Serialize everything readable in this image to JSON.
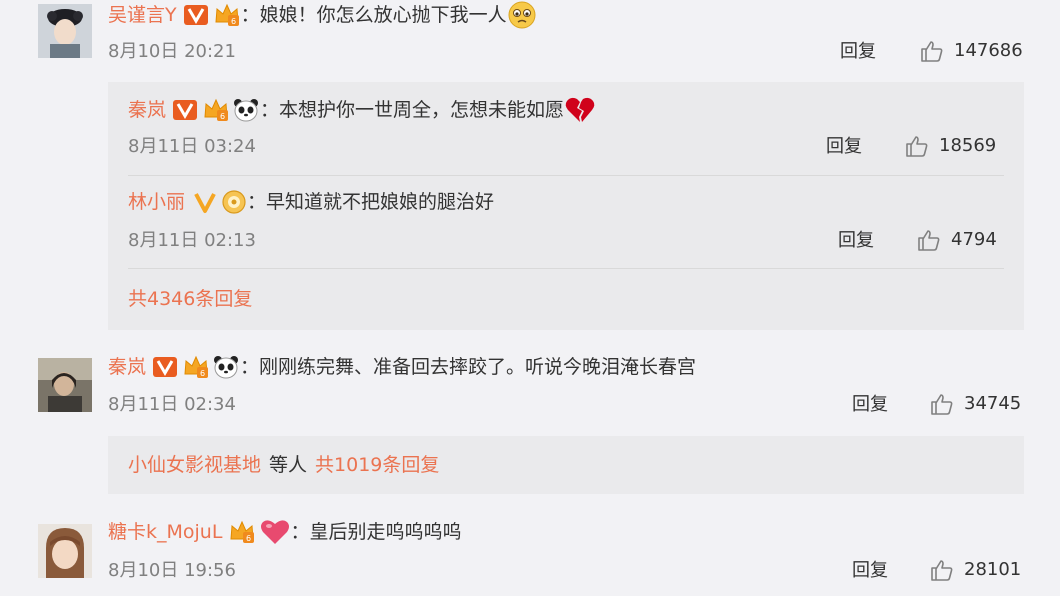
{
  "colors": {
    "page_bg": "#f2f2f5",
    "subbox_bg": "#eaeaec",
    "username": "#eb7350",
    "verified_v": "#e95c20",
    "member_v": "#f5a623",
    "heart": "#e84a6f",
    "broken_heart": "#d0021b"
  },
  "reply_label": "回复",
  "comments": [
    {
      "username": "吴谨言Y",
      "badges": [
        "verified-v-icon",
        "vip-crown-icon"
      ],
      "text": "：娘娘！你怎么放心抛下我一人",
      "emoji": "crying-face-icon",
      "time": "8月10日 20:21",
      "likes": "147686",
      "replies": [
        {
          "username": "秦岚",
          "badges": [
            "verified-v-icon",
            "vip-crown-icon",
            "panda-icon"
          ],
          "text": "：本想护你一世周全，怎想未能如愿",
          "emoji": "broken-heart-icon",
          "time": "8月11日 03:24",
          "likes": "18569"
        },
        {
          "username": "林小丽",
          "badges": [
            "member-v-icon",
            "medal-icon"
          ],
          "text": "：早知道就不把娘娘的腿治好",
          "time": "8月11日 02:13",
          "likes": "4794"
        }
      ],
      "more_replies": "共4346条回复"
    },
    {
      "username": "秦岚",
      "badges": [
        "verified-v-icon",
        "vip-crown-icon",
        "panda-icon"
      ],
      "text": "：刚刚练完舞、准备回去摔跤了。听说今晚泪淹长春宫",
      "time": "8月11日 02:34",
      "likes": "34745",
      "reply_summary": {
        "user": "小仙女影视基地",
        "others": "等人",
        "more": "共1019条回复"
      }
    },
    {
      "username": "糖卡k_MojuL",
      "badges": [
        "vip-crown-icon",
        "heart-icon"
      ],
      "text": "：皇后别走呜呜呜呜",
      "time": "8月10日 19:56",
      "likes": "28101"
    }
  ]
}
